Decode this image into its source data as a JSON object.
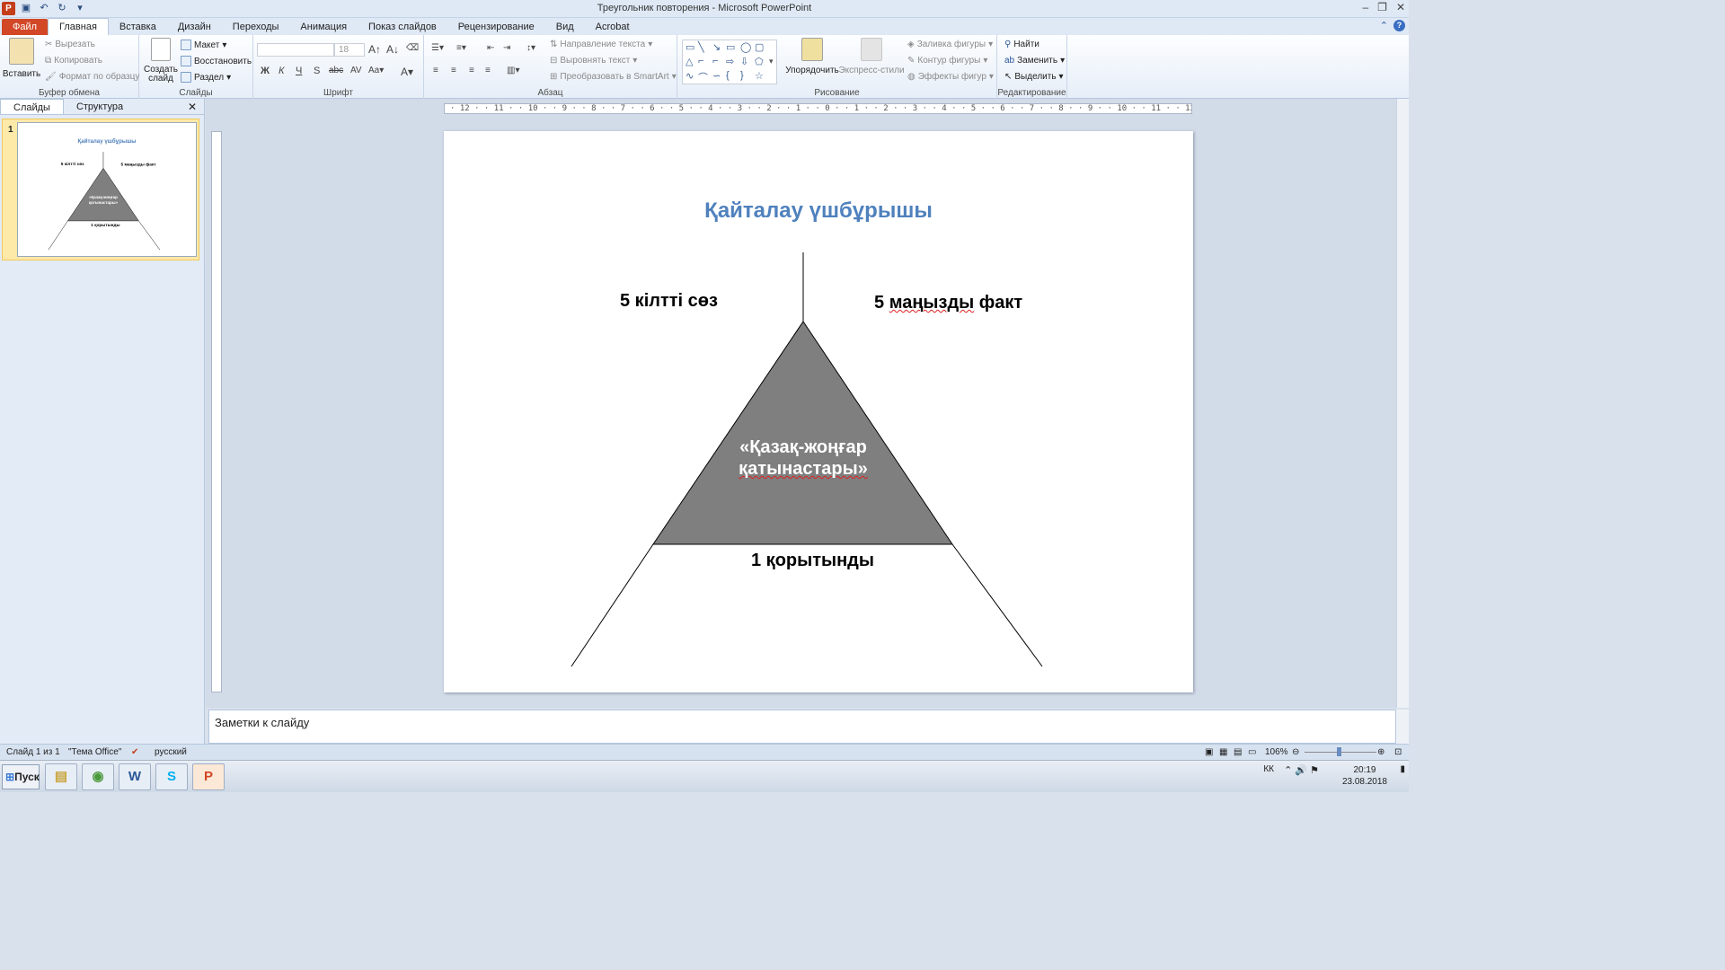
{
  "window": {
    "title": "Треугольник повторения  -  Microsoft PowerPoint",
    "app_icon": "P"
  },
  "tabs": [
    "Файл",
    "Главная",
    "Вставка",
    "Дизайн",
    "Переходы",
    "Анимация",
    "Показ слайдов",
    "Рецензирование",
    "Вид",
    "Acrobat"
  ],
  "ribbon": {
    "clipboard": {
      "paste": "Вставить",
      "cut": "Вырезать",
      "copy": "Копировать",
      "format_painter": "Формат по образцу",
      "label": "Буфер обмена"
    },
    "slides": {
      "new_slide": "Создать слайд",
      "layout": "Макет",
      "reset": "Восстановить",
      "section": "Раздел",
      "label": "Слайды"
    },
    "font": {
      "size": "18",
      "bold": "Ж",
      "italic": "К",
      "underline": "Ч",
      "strike": "S",
      "label": "Шрифт"
    },
    "paragraph": {
      "text_direction": "Направление текста",
      "align_text": "Выровнять текст",
      "smartart": "Преобразовать в SmartArt",
      "label": "Абзац"
    },
    "drawing": {
      "arrange": "Упорядочить",
      "quick_styles": "Экспресс-стили",
      "fill": "Заливка фигуры",
      "outline": "Контур фигуры",
      "effects": "Эффекты фигур",
      "label": "Рисование"
    },
    "editing": {
      "find": "Найти",
      "replace": "Заменить",
      "select": "Выделить",
      "label": "Редактирование"
    }
  },
  "panel": {
    "tab_slides": "Слайды",
    "tab_outline": "Структура",
    "slide_number": "1"
  },
  "slide": {
    "title": "Қайталау үшбұрышы",
    "left_label": "5 кілтті сөз",
    "right_label": "5 маңызды факт",
    "triangle_line1": "«Қазақ-жоңғар",
    "triangle_line2": "қатынастары»",
    "bottom_label": "1 қорытынды",
    "triangle_fill": "#7f7f7f",
    "title_color": "#4f81bd"
  },
  "notes": {
    "placeholder": "Заметки к слайду"
  },
  "status": {
    "slide_counter": "Слайд 1 из 1",
    "theme": "\"Тема Office\"",
    "language": "русский",
    "zoom": "106%"
  },
  "taskbar": {
    "start": "Пуск",
    "lang": "КК",
    "time": "20:19",
    "date": "23.08.2018"
  }
}
